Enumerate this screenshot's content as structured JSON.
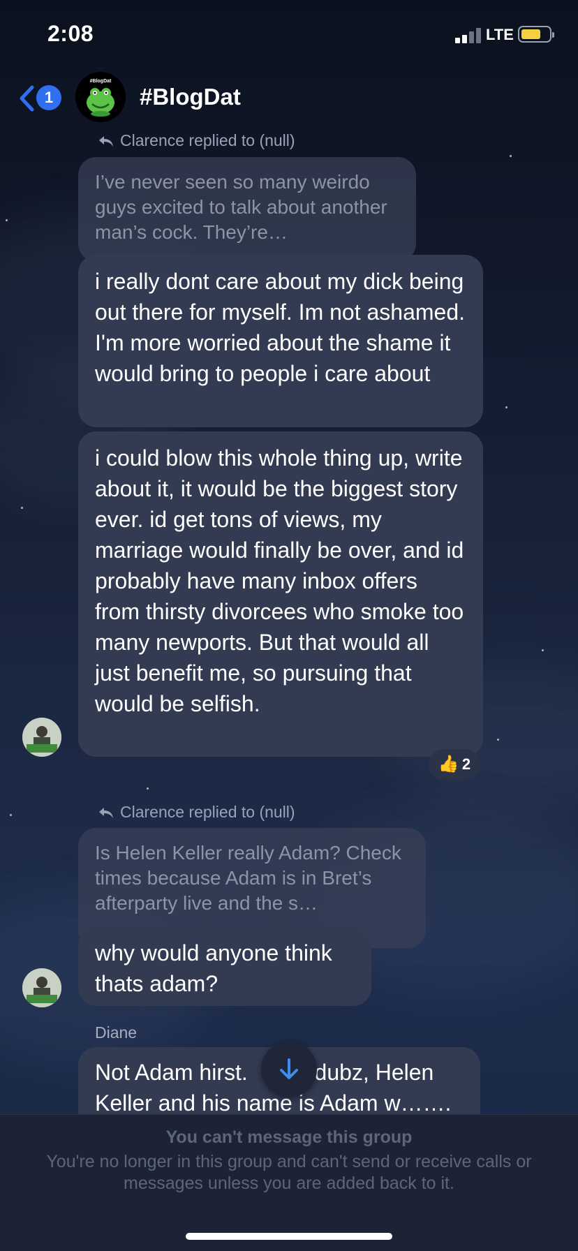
{
  "status_bar": {
    "time": "2:08",
    "network": "LTE",
    "battery_color": "#f5d142"
  },
  "header": {
    "unread_count": "1",
    "avatar_label": "#BlogDat",
    "title": "#BlogDat"
  },
  "messages": [
    {
      "reply_label": "Clarence replied to (null)",
      "quoted_text": "I’ve never seen so many weirdo guys excited to talk about another man’s cock.  They’re…",
      "bubbles": [
        "i really dont care about my dick being out there for myself. Im not ashamed. I'm more worried about the shame it would bring to people i care about",
        "i could blow this whole thing up, write about it, it would be the biggest story ever. id get tons of views, my marriage would finally be over, and id probably have many inbox offers from thirsty divorcees who smoke too many newports. But that would all just benefit me, so pursuing that would be selfish."
      ],
      "reaction": {
        "emoji": "thumbs-up",
        "count": "2"
      }
    },
    {
      "reply_label": "Clarence replied to (null)",
      "quoted_text": "Is Helen Keller really Adam? Check times because Adam is in Bret’s afterparty live and the s…",
      "bubbles": [
        "why would anyone think thats adam?"
      ]
    },
    {
      "sender": "Diane",
      "bubbles": [
        "Not Adam hirst.",
        "dubz, Helen Keller and his name is Adam w……."
      ]
    }
  ],
  "footer": {
    "title": "You can't message this group",
    "text": "You're no longer in this group and can't send or receive calls or messages unless you are added back to it."
  },
  "colors": {
    "accent": "#2f6ff0",
    "bubble": "#333b52",
    "background": "#131c30"
  }
}
